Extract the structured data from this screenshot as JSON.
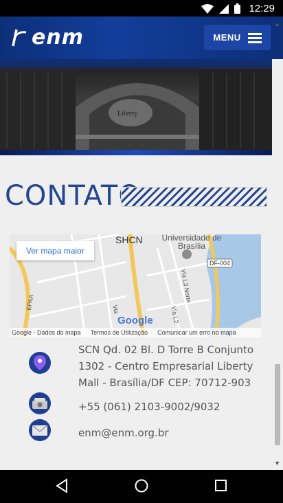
{
  "status_bar": {
    "time": "12:29"
  },
  "header": {
    "logo_text": "enm",
    "menu_label": "MENU"
  },
  "contact_section": {
    "title": "CONTATO"
  },
  "map": {
    "larger_map_link": "Ver mapa maior",
    "labels": {
      "shcn": "SHCN",
      "university": "Universidade de Brasília",
      "df004": "DF-004",
      "epaa": "EPAA",
      "via_l3": "Via L3 Norte",
      "via_l2": "Via L2",
      "via": "Via"
    },
    "footer": {
      "data": "Google - Dados do mapa",
      "terms": "Termos de Utilização",
      "report": "Comunicar um erro no mapa"
    },
    "google_logo": "Google"
  },
  "contact": {
    "address_line1": "SCN Qd. 02 Bl. D Torre B Conjunto",
    "address_line2": "1302 - Centro Empresarial Liberty",
    "address_line3": "Mall - Brasília/DF CEP: 70712-903",
    "phone": "+55 (061) 2103-9002/9032",
    "email": "enm@enm.org.br"
  },
  "colors": {
    "brand_blue": "#1f4091",
    "title_blue": "#25468f"
  }
}
